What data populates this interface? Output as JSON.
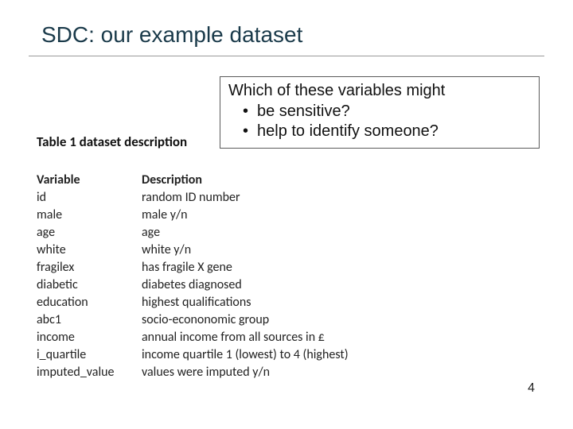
{
  "title": "SDC: our example dataset",
  "question": {
    "lead": "Which of these variables might",
    "bullets": [
      "be sensitive?",
      "help to identify someone?"
    ]
  },
  "table": {
    "title": "Table 1 dataset description",
    "header": {
      "var": "Variable",
      "desc": "Description"
    },
    "rows": [
      {
        "var": "id",
        "desc": "random ID number"
      },
      {
        "var": "male",
        "desc": "male y/n"
      },
      {
        "var": "age",
        "desc": "age"
      },
      {
        "var": "white",
        "desc": "white y/n"
      },
      {
        "var": "fragilex",
        "desc": "has fragile X gene"
      },
      {
        "var": "diabetic",
        "desc": "diabetes diagnosed"
      },
      {
        "var": "education",
        "desc": "highest qualifications"
      },
      {
        "var": "abc1",
        "desc": "socio-econonomic group"
      },
      {
        "var": "income",
        "desc": "annual income from all sources in £"
      },
      {
        "var": "i_quartile",
        "desc": "income quartile 1 (lowest) to 4 (highest)"
      },
      {
        "var": "imputed_value",
        "desc": "values were imputed y/n"
      }
    ]
  },
  "page_number": "4"
}
